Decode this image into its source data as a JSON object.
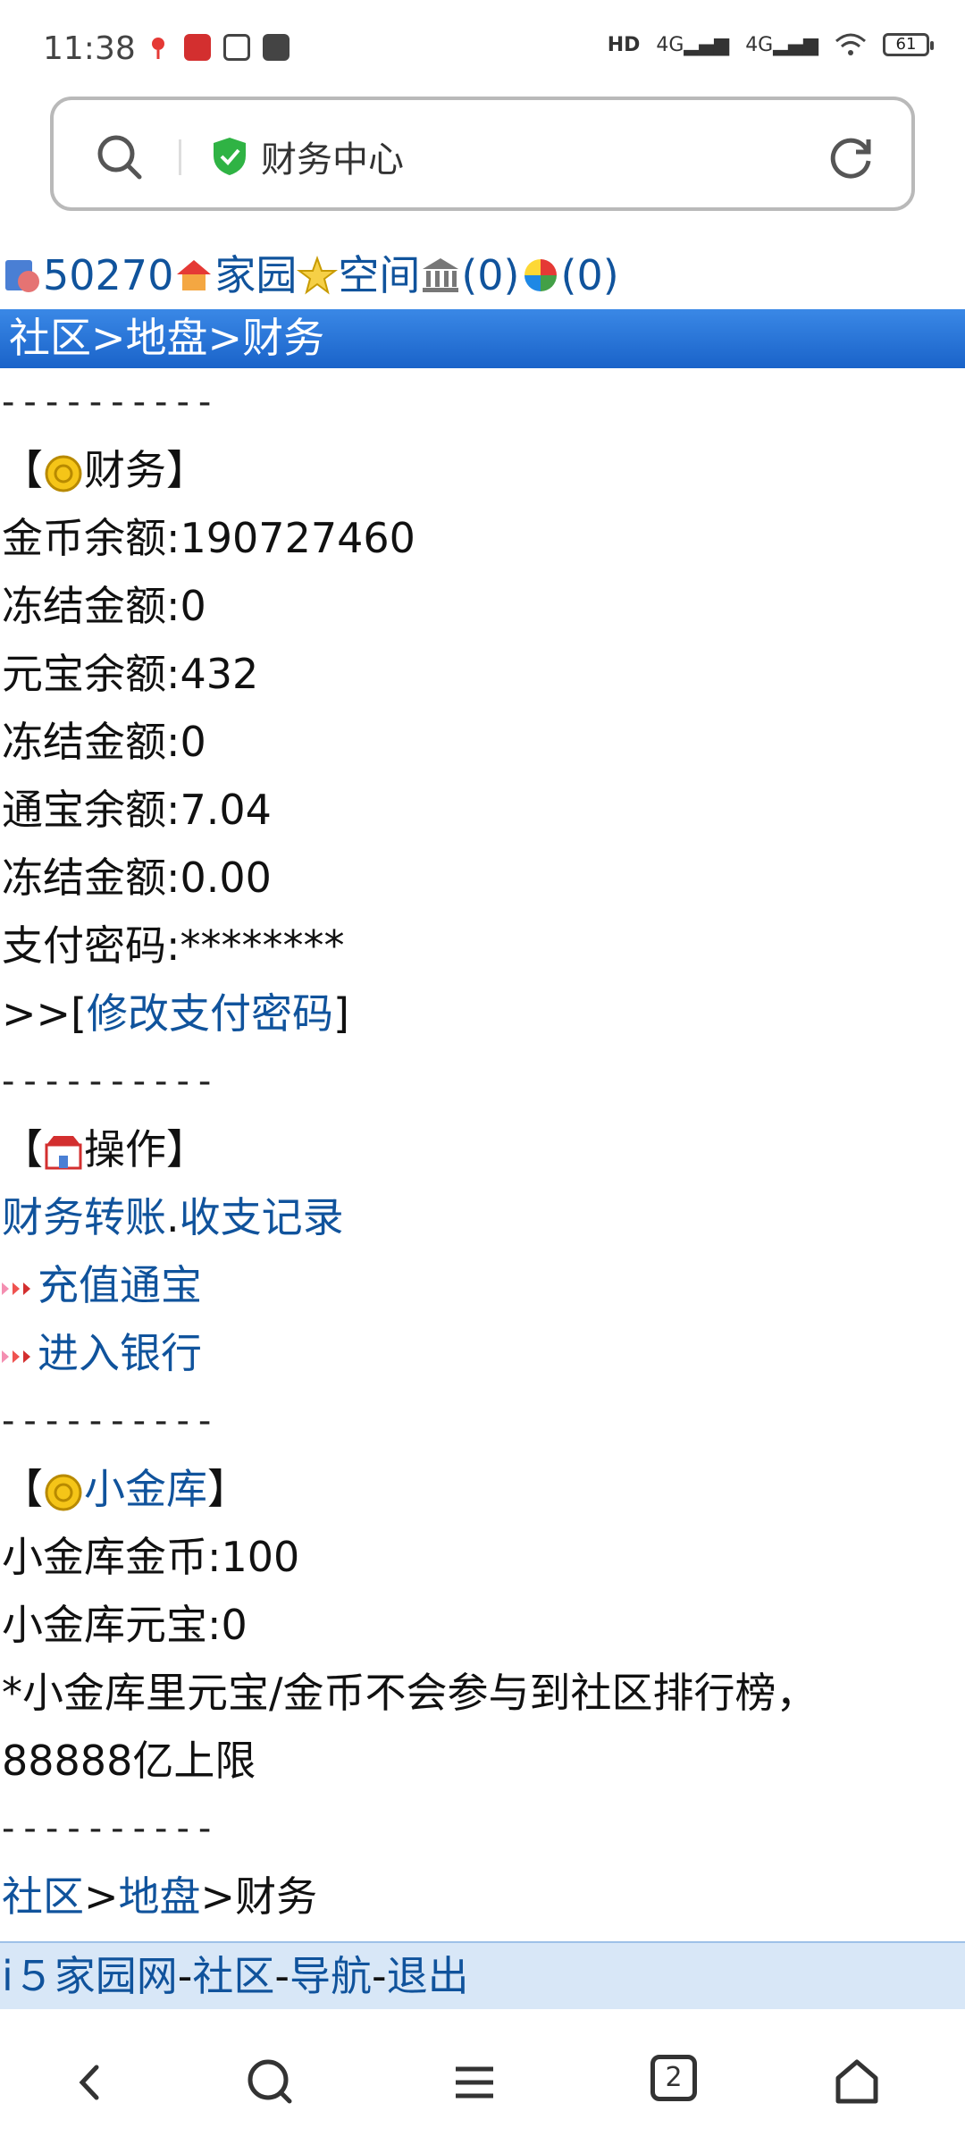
{
  "status": {
    "time": "11:38",
    "battery": "61"
  },
  "address_bar": {
    "title": "财务中心"
  },
  "userbar": {
    "id": "50270",
    "home": "家园",
    "space": "空间",
    "bank_count": "(0)",
    "msg_count": "(0)"
  },
  "breadcrumb_top": {
    "a": "社区",
    "sep1": ">",
    "b": "地盘",
    "sep2": ">",
    "c": "财务"
  },
  "dashes": "----------",
  "finance": {
    "header_l": "【",
    "title": "财务",
    "header_r": "】",
    "gold_balance": "金币余额:190727460",
    "gold_frozen": "冻结金额:0",
    "yuanbao_balance": "元宝余额:432",
    "yuanbao_frozen": "冻结金额:0",
    "tongbao_balance": "通宝余额:7.04",
    "tongbao_frozen": "冻结金额:0.00",
    "pay_password": "支付密码:********",
    "modify_prefix": ">>[",
    "modify_link": "修改支付密码",
    "modify_suffix": "]"
  },
  "operations": {
    "header_l": "【",
    "title": "操作",
    "header_r": "】",
    "transfer": "财务转账",
    "dot": ".",
    "records": "收支记录",
    "recharge": "充值通宝",
    "bank": "进入银行"
  },
  "vault": {
    "header_l": "【",
    "title": "小金库",
    "header_r": "】",
    "gold": "小金库金币:100",
    "yuanbao": "小金库元宝:0",
    "note1": "*小金库里元宝/金币不会参与到社区排行榜，",
    "note2": "88888亿上限"
  },
  "breadcrumb_bottom": {
    "a": "社区",
    "sep1": ">",
    "b": "地盘",
    "sep2": ">",
    "c": "财务"
  },
  "footer": {
    "site": "i５家园网",
    "d1": "-",
    "community": "社区",
    "d2": "-",
    "nav": "导航",
    "d3": "-",
    "logout": "退出"
  },
  "bottom_nav": {
    "tabs": "2"
  }
}
